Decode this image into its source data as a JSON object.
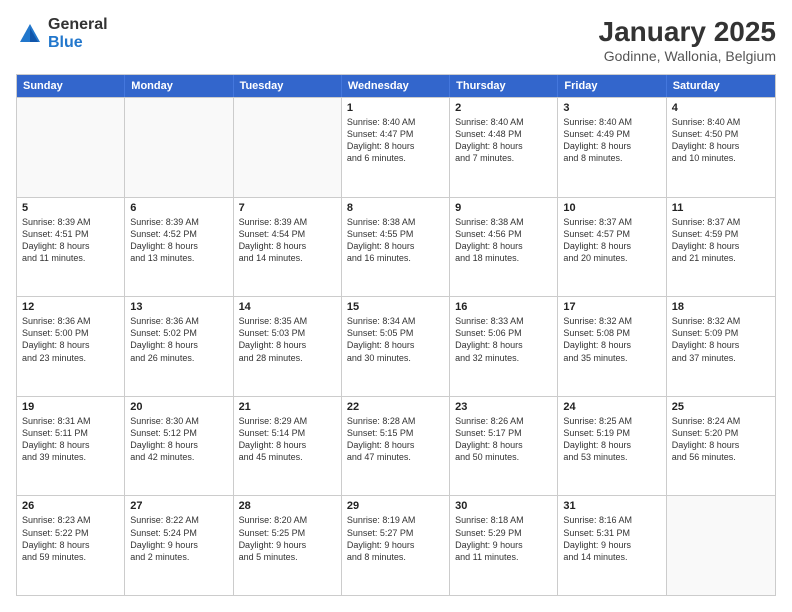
{
  "logo": {
    "general": "General",
    "blue": "Blue"
  },
  "title": "January 2025",
  "location": "Godinne, Wallonia, Belgium",
  "header_days": [
    "Sunday",
    "Monday",
    "Tuesday",
    "Wednesday",
    "Thursday",
    "Friday",
    "Saturday"
  ],
  "rows": [
    [
      {
        "day": "",
        "text": ""
      },
      {
        "day": "",
        "text": ""
      },
      {
        "day": "",
        "text": ""
      },
      {
        "day": "1",
        "text": "Sunrise: 8:40 AM\nSunset: 4:47 PM\nDaylight: 8 hours\nand 6 minutes."
      },
      {
        "day": "2",
        "text": "Sunrise: 8:40 AM\nSunset: 4:48 PM\nDaylight: 8 hours\nand 7 minutes."
      },
      {
        "day": "3",
        "text": "Sunrise: 8:40 AM\nSunset: 4:49 PM\nDaylight: 8 hours\nand 8 minutes."
      },
      {
        "day": "4",
        "text": "Sunrise: 8:40 AM\nSunset: 4:50 PM\nDaylight: 8 hours\nand 10 minutes."
      }
    ],
    [
      {
        "day": "5",
        "text": "Sunrise: 8:39 AM\nSunset: 4:51 PM\nDaylight: 8 hours\nand 11 minutes."
      },
      {
        "day": "6",
        "text": "Sunrise: 8:39 AM\nSunset: 4:52 PM\nDaylight: 8 hours\nand 13 minutes."
      },
      {
        "day": "7",
        "text": "Sunrise: 8:39 AM\nSunset: 4:54 PM\nDaylight: 8 hours\nand 14 minutes."
      },
      {
        "day": "8",
        "text": "Sunrise: 8:38 AM\nSunset: 4:55 PM\nDaylight: 8 hours\nand 16 minutes."
      },
      {
        "day": "9",
        "text": "Sunrise: 8:38 AM\nSunset: 4:56 PM\nDaylight: 8 hours\nand 18 minutes."
      },
      {
        "day": "10",
        "text": "Sunrise: 8:37 AM\nSunset: 4:57 PM\nDaylight: 8 hours\nand 20 minutes."
      },
      {
        "day": "11",
        "text": "Sunrise: 8:37 AM\nSunset: 4:59 PM\nDaylight: 8 hours\nand 21 minutes."
      }
    ],
    [
      {
        "day": "12",
        "text": "Sunrise: 8:36 AM\nSunset: 5:00 PM\nDaylight: 8 hours\nand 23 minutes."
      },
      {
        "day": "13",
        "text": "Sunrise: 8:36 AM\nSunset: 5:02 PM\nDaylight: 8 hours\nand 26 minutes."
      },
      {
        "day": "14",
        "text": "Sunrise: 8:35 AM\nSunset: 5:03 PM\nDaylight: 8 hours\nand 28 minutes."
      },
      {
        "day": "15",
        "text": "Sunrise: 8:34 AM\nSunset: 5:05 PM\nDaylight: 8 hours\nand 30 minutes."
      },
      {
        "day": "16",
        "text": "Sunrise: 8:33 AM\nSunset: 5:06 PM\nDaylight: 8 hours\nand 32 minutes."
      },
      {
        "day": "17",
        "text": "Sunrise: 8:32 AM\nSunset: 5:08 PM\nDaylight: 8 hours\nand 35 minutes."
      },
      {
        "day": "18",
        "text": "Sunrise: 8:32 AM\nSunset: 5:09 PM\nDaylight: 8 hours\nand 37 minutes."
      }
    ],
    [
      {
        "day": "19",
        "text": "Sunrise: 8:31 AM\nSunset: 5:11 PM\nDaylight: 8 hours\nand 39 minutes."
      },
      {
        "day": "20",
        "text": "Sunrise: 8:30 AM\nSunset: 5:12 PM\nDaylight: 8 hours\nand 42 minutes."
      },
      {
        "day": "21",
        "text": "Sunrise: 8:29 AM\nSunset: 5:14 PM\nDaylight: 8 hours\nand 45 minutes."
      },
      {
        "day": "22",
        "text": "Sunrise: 8:28 AM\nSunset: 5:15 PM\nDaylight: 8 hours\nand 47 minutes."
      },
      {
        "day": "23",
        "text": "Sunrise: 8:26 AM\nSunset: 5:17 PM\nDaylight: 8 hours\nand 50 minutes."
      },
      {
        "day": "24",
        "text": "Sunrise: 8:25 AM\nSunset: 5:19 PM\nDaylight: 8 hours\nand 53 minutes."
      },
      {
        "day": "25",
        "text": "Sunrise: 8:24 AM\nSunset: 5:20 PM\nDaylight: 8 hours\nand 56 minutes."
      }
    ],
    [
      {
        "day": "26",
        "text": "Sunrise: 8:23 AM\nSunset: 5:22 PM\nDaylight: 8 hours\nand 59 minutes."
      },
      {
        "day": "27",
        "text": "Sunrise: 8:22 AM\nSunset: 5:24 PM\nDaylight: 9 hours\nand 2 minutes."
      },
      {
        "day": "28",
        "text": "Sunrise: 8:20 AM\nSunset: 5:25 PM\nDaylight: 9 hours\nand 5 minutes."
      },
      {
        "day": "29",
        "text": "Sunrise: 8:19 AM\nSunset: 5:27 PM\nDaylight: 9 hours\nand 8 minutes."
      },
      {
        "day": "30",
        "text": "Sunrise: 8:18 AM\nSunset: 5:29 PM\nDaylight: 9 hours\nand 11 minutes."
      },
      {
        "day": "31",
        "text": "Sunrise: 8:16 AM\nSunset: 5:31 PM\nDaylight: 9 hours\nand 14 minutes."
      },
      {
        "day": "",
        "text": ""
      }
    ]
  ]
}
